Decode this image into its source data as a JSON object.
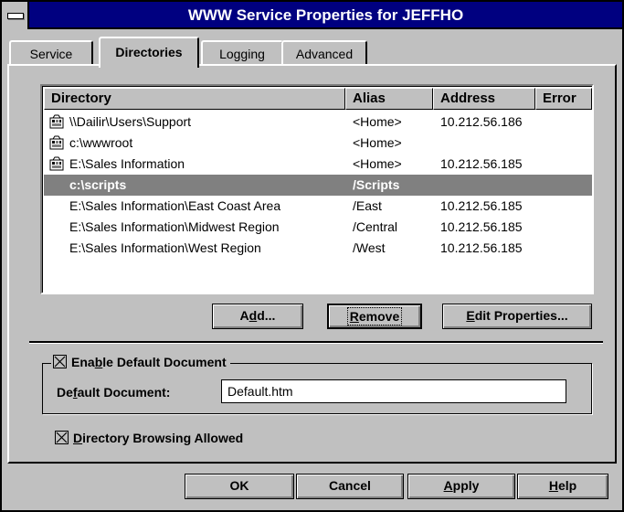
{
  "window": {
    "title": "WWW Service Properties for JEFFHO"
  },
  "tabs": [
    {
      "label": "Service"
    },
    {
      "label": "Directories"
    },
    {
      "label": "Logging"
    },
    {
      "label": "Advanced"
    }
  ],
  "directory_list": {
    "columns": [
      "Directory",
      "Alias",
      "Address",
      "Error"
    ],
    "rows": [
      {
        "directory": "\\\\Dailir\\Users\\Support",
        "alias": "<Home>",
        "address": "10.212.56.186",
        "error": "",
        "icon": "virtual-server-icon"
      },
      {
        "directory": "c:\\wwwroot",
        "alias": "<Home>",
        "address": "",
        "error": "",
        "icon": "virtual-server-icon"
      },
      {
        "directory": "E:\\Sales Information",
        "alias": "<Home>",
        "address": "10.212.56.185",
        "error": "",
        "icon": "virtual-server-icon"
      },
      {
        "directory": "c:\\scripts",
        "alias": "/Scripts",
        "address": "",
        "error": "",
        "selected": true
      },
      {
        "directory": "E:\\Sales Information\\East Coast Area",
        "alias": "/East",
        "address": "10.212.56.185",
        "error": ""
      },
      {
        "directory": "E:\\Sales Information\\Midwest Region",
        "alias": "/Central",
        "address": "10.212.56.185",
        "error": ""
      },
      {
        "directory": "E:\\Sales Information\\West Region",
        "alias": "/West",
        "address": "10.212.56.185",
        "error": ""
      }
    ]
  },
  "buttons": {
    "add": {
      "pre": "A",
      "key": "d",
      "post": "d..."
    },
    "remove": {
      "pre": "",
      "key": "R",
      "post": "emove"
    },
    "edit": {
      "pre": "",
      "key": "E",
      "post": "dit Properties..."
    },
    "ok": "OK",
    "cancel": "Cancel",
    "apply": {
      "pre": "",
      "key": "A",
      "post": "pply"
    },
    "help": {
      "pre": "",
      "key": "H",
      "post": "elp"
    }
  },
  "default_document": {
    "enable_label": {
      "pre": "Ena",
      "key": "b",
      "post": "le Default Document"
    },
    "enabled": true,
    "field_label": {
      "pre": "De",
      "key": "f",
      "post": "ault Document:"
    },
    "value": "Default.htm"
  },
  "directory_browsing": {
    "label": {
      "pre": "",
      "key": "D",
      "post": "irectory Browsing Allowed"
    },
    "checked": true
  },
  "colors": {
    "titlebar": "#000080",
    "face": "#c0c0c0",
    "selection": "#808080"
  }
}
